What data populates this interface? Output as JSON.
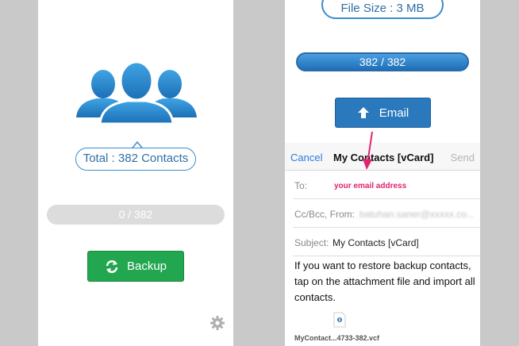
{
  "left": {
    "total_label": "Total : 382 Contacts",
    "progress": "0 / 382",
    "backup_label": "Backup"
  },
  "right": {
    "file_size": "File Size : 3 MB",
    "progress": "382 / 382",
    "email_label": "Email",
    "compose": {
      "cancel": "Cancel",
      "title": "My Contacts [vCard]",
      "send": "Send",
      "to_label": "To:",
      "to_hint": "your email address",
      "cc_label": "Cc/Bcc, From:",
      "cc_value": "batuhan.saner@xxxxx.co...",
      "subject_label": "Subject:",
      "subject_value": "My Contacts [vCard]",
      "body": "If you want to restore backup contacts, tap on the attachment file and import all contacts.",
      "attachment_name": "MyContact...4733-382.vcf"
    }
  },
  "colors": {
    "accent_blue": "#3b8dcc",
    "backup_green": "#22a64f",
    "email_blue": "#2a79bd",
    "hint_pink": "#e2226e"
  }
}
